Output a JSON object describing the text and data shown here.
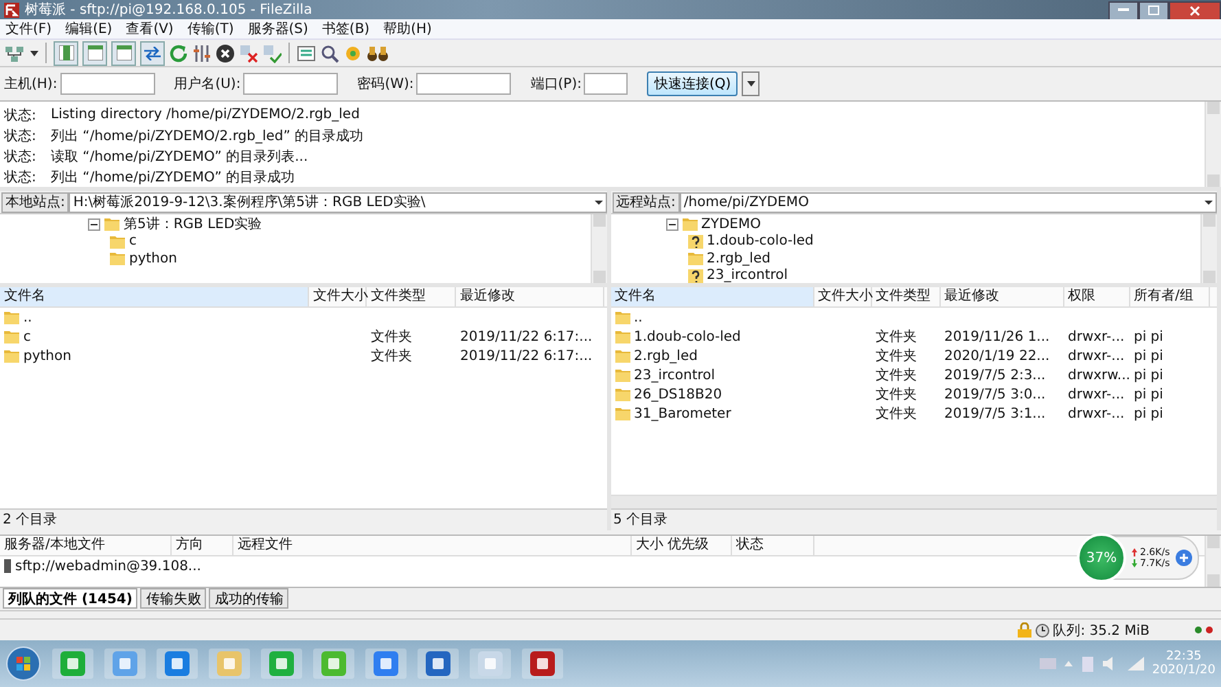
{
  "window": {
    "title": "树莓派 - sftp://pi@192.168.0.105 - FileZilla"
  },
  "menu": [
    "文件(F)",
    "编辑(E)",
    "查看(V)",
    "传输(T)",
    "服务器(S)",
    "书签(B)",
    "帮助(H)"
  ],
  "quickconnect": {
    "fields": [
      {
        "label": "主机(H):"
      },
      {
        "label": "用户名(U):"
      },
      {
        "label": "密码(W):"
      },
      {
        "label": "端口(P):"
      }
    ],
    "button": "快速连接(Q)"
  },
  "log": [
    {
      "label": "状态:",
      "message": "Listing directory /home/pi/ZYDEMO/2.rgb_led"
    },
    {
      "label": "状态:",
      "message": "列出 “/home/pi/ZYDEMO/2.rgb_led” 的目录成功"
    },
    {
      "label": "状态:",
      "message": "读取 “/home/pi/ZYDEMO” 的目录列表..."
    },
    {
      "label": "状态:",
      "message": "列出 “/home/pi/ZYDEMO” 的目录成功"
    }
  ],
  "panes": [
    {
      "site_label": "本地站点:",
      "path": "H:\\树莓派2019-9-12\\3.案例程序\\第5讲：RGB LED实验\\",
      "tree": [
        {
          "name": "第5讲：RGB LED实验",
          "kind": "folder",
          "expanded": true,
          "children": [
            {
              "name": "c",
              "kind": "folder"
            },
            {
              "name": "python",
              "kind": "folder"
            }
          ]
        }
      ],
      "columns": [
        "文件名",
        "文件大小",
        "文件类型",
        "最近修改"
      ],
      "rows": [
        {
          "cells": [
            "..",
            "",
            "",
            ""
          ]
        },
        {
          "cells": [
            "c",
            "",
            "文件夹",
            "2019/11/22 6:17:..."
          ]
        },
        {
          "cells": [
            "python",
            "",
            "文件夹",
            "2019/11/22 6:17:..."
          ]
        }
      ],
      "status": "2 个目录"
    },
    {
      "site_label": "远程站点:",
      "path": "/home/pi/ZYDEMO",
      "tree": [
        {
          "name": "ZYDEMO",
          "kind": "folder",
          "expanded": true,
          "children": [
            {
              "name": "1.doub-colo-led",
              "kind": "unknown"
            },
            {
              "name": "2.rgb_led",
              "kind": "folder"
            },
            {
              "name": "23_ircontrol",
              "kind": "unknown"
            }
          ]
        }
      ],
      "columns": [
        "文件名",
        "文件大小",
        "文件类型",
        "最近修改",
        "权限",
        "所有者/组"
      ],
      "rows": [
        {
          "cells": [
            "..",
            "",
            "",
            "",
            "",
            ""
          ]
        },
        {
          "cells": [
            "1.doub-colo-led",
            "",
            "文件夹",
            "2019/11/26 1...",
            "drwxr-...",
            "pi pi"
          ]
        },
        {
          "cells": [
            "2.rgb_led",
            "",
            "文件夹",
            "2020/1/19 22...",
            "drwxr-...",
            "pi pi"
          ]
        },
        {
          "cells": [
            "23_ircontrol",
            "",
            "文件夹",
            "2019/7/5 2:3...",
            "drwxrw...",
            "pi pi"
          ]
        },
        {
          "cells": [
            "26_DS18B20",
            "",
            "文件夹",
            "2019/7/5 3:0...",
            "drwxr-...",
            "pi pi"
          ]
        },
        {
          "cells": [
            "31_Barometer",
            "",
            "文件夹",
            "2019/7/5 3:1...",
            "drwxr-...",
            "pi pi"
          ]
        }
      ],
      "status": "5 个目录"
    }
  ],
  "queue": {
    "columns": [
      "服务器/本地文件",
      "方向",
      "远程文件",
      "大小",
      "优先级",
      "状态"
    ],
    "rows": [
      {
        "server": "sftp://webadmin@39.108..."
      }
    ],
    "tabs": [
      {
        "label": "列队的文件 (1454)",
        "selected": true
      },
      {
        "label": "传输失败",
        "selected": false
      },
      {
        "label": "成功的传输",
        "selected": false
      }
    ]
  },
  "status_bar": {
    "queue": "队列: 35.2 MiB"
  },
  "speed_widget": {
    "percent": "37%",
    "upload": "2.6K/s",
    "download": "7.7K/s"
  },
  "taskbar": {
    "time": "22:35",
    "date": "2020/1/20"
  }
}
